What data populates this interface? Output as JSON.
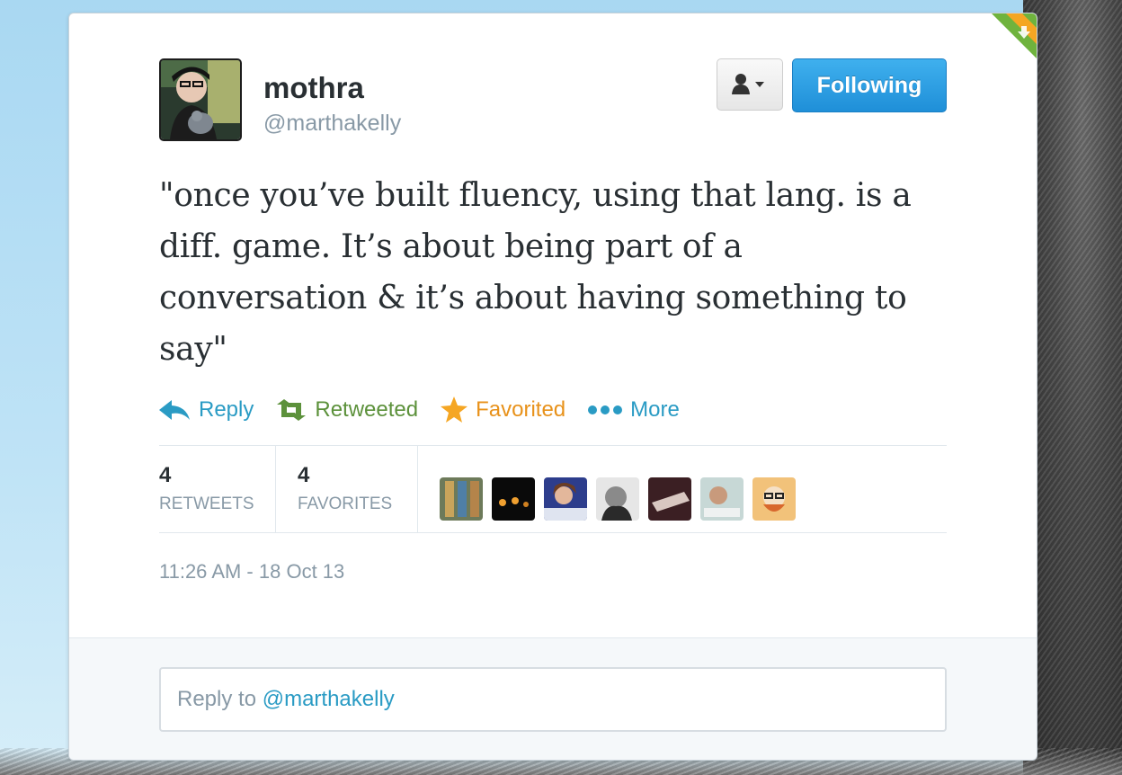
{
  "user": {
    "display_name": "mothra",
    "handle": "@marthakelly"
  },
  "header_buttons": {
    "user_actions_icon": "person-dropdown-icon",
    "follow_label": "Following"
  },
  "tweet": {
    "text": "\"once you’ve built fluency, using that lang. is a diff. game. It’s about being part of a conversation & it’s about having something to say\""
  },
  "actions": {
    "reply": "Reply",
    "retweet": "Retweeted",
    "favorite": "Favorited",
    "more": "More"
  },
  "stats": {
    "retweets_count": "4",
    "retweets_label": "RETWEETS",
    "favorites_count": "4",
    "favorites_label": "FAVORITES"
  },
  "timestamp": "11:26 AM - 18 Oct 13",
  "reply_box": {
    "prefix": "Reply to ",
    "mention": "@marthakelly"
  },
  "colors": {
    "link": "#2a9bc4",
    "retweet": "#5c913b",
    "favorite": "#e8921b",
    "follow_button": "#1f8fd8"
  }
}
